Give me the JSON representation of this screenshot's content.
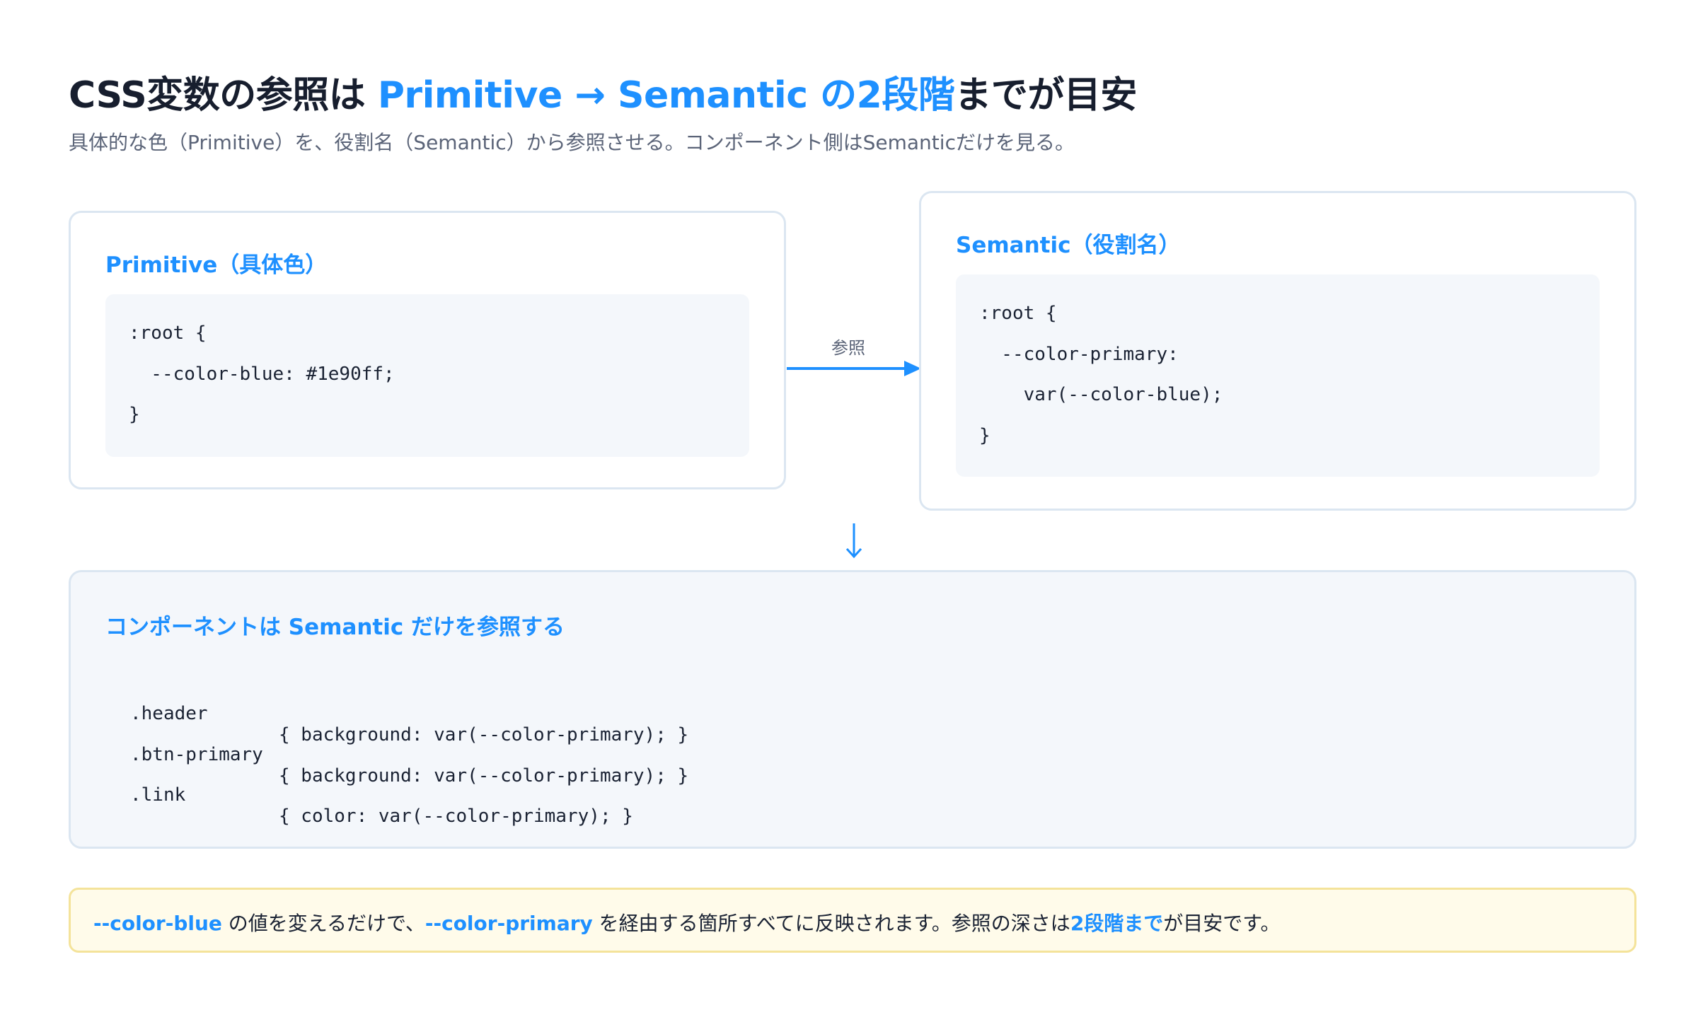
{
  "title": {
    "part1": "CSS変数の参照は ",
    "accent": "Primitive → Semantic の2段階",
    "part2": "までが目安"
  },
  "subtitle": "具体的な色（Primitive）を、役割名（Semantic）から参照させる。コンポーネント側はSemanticだけを見る。",
  "primitive_card": {
    "heading": "Primitive（具体色）",
    "code": [
      ":root {",
      "  --color-blue: #1e90ff;",
      "}"
    ]
  },
  "arrow": {
    "label": "参照"
  },
  "semantic_card": {
    "heading": "Semantic（役割名）",
    "code": [
      ":root {",
      "  --color-primary:",
      "    var(--color-blue);",
      "}"
    ]
  },
  "down_arrow": "↓",
  "component_card": {
    "heading": "コンポーネントは Semantic だけを参照する",
    "rows": [
      {
        "selector": ".header",
        "rule": "{ background: var(--color-primary); }"
      },
      {
        "selector": ".btn-primary",
        "rule": "{ background: var(--color-primary); }"
      },
      {
        "selector": ".link",
        "rule": "{ color: var(--color-primary); }"
      }
    ]
  },
  "note": {
    "var1": "--color-blue",
    "text1": " の値を変えるだけで、",
    "var2": "--color-primary",
    "text2": " を経由する箇所すべてに反映されます。参照の深さは",
    "emphasis": "2段階まで",
    "text3": "が目安です。"
  },
  "colors": {
    "accent": "#1e90ff",
    "title": "#171e2e",
    "muted": "#5b6478",
    "card_border": "#dbe6f1",
    "code_bg": "#f4f7fb",
    "note_bg": "#fffbea",
    "note_border": "#f4e39a"
  }
}
